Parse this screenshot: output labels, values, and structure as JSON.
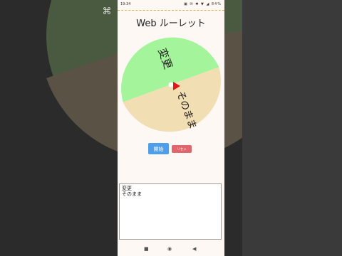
{
  "status_bar": {
    "time": "19:34",
    "icons": "▣ ✉ ✱ ▼ ◢ 84%"
  },
  "app": {
    "title": "Web ルーレット"
  },
  "wheel": {
    "segments": [
      {
        "label": "変更",
        "color": "#a4f49b"
      },
      {
        "label": "そのまま",
        "color": "#f2deb3"
      }
    ],
    "pointer_color": "#e3171b"
  },
  "buttons": {
    "start_label": "開始",
    "reset_label": "リセット"
  },
  "items_textarea": {
    "value": "変更\nそのまま"
  },
  "overlay": {
    "capcut_icon": "capcut-icon"
  }
}
